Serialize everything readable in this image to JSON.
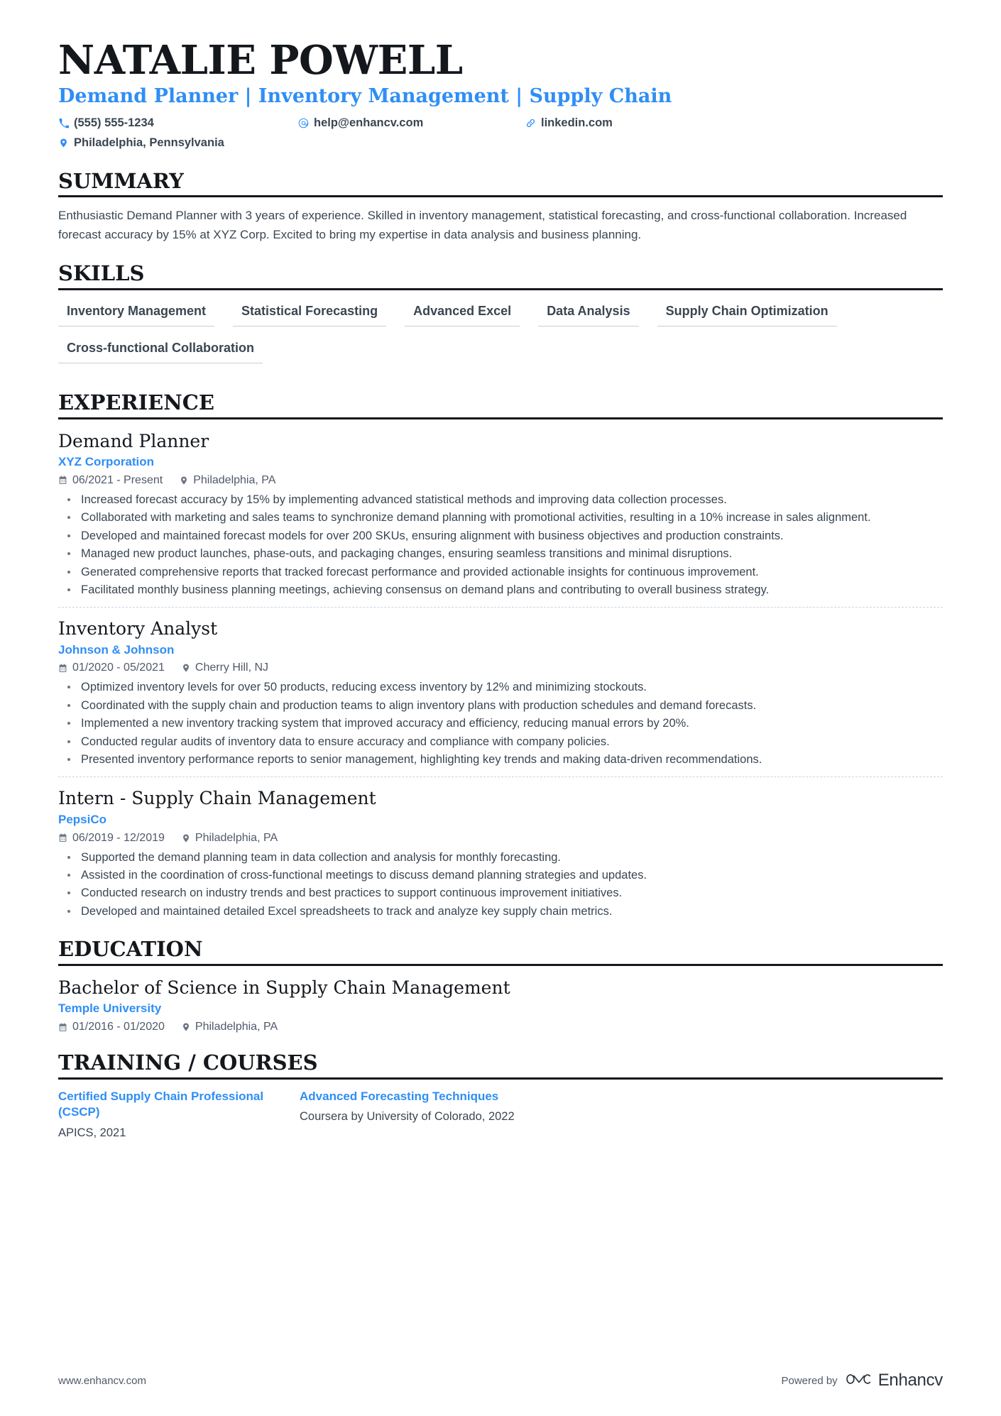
{
  "accent_color": "#2f8ef4",
  "text_color": "#3a4652",
  "heading_color": "#14181d",
  "header": {
    "name": "NATALIE POWELL",
    "headline": "Demand Planner | Inventory Management | Supply Chain",
    "contacts": [
      {
        "icon": "phone-icon",
        "text": "(555) 555-1234"
      },
      {
        "icon": "email-icon",
        "text": "help@enhancv.com"
      },
      {
        "icon": "link-icon",
        "text": "linkedin.com"
      },
      {
        "icon": "location-icon",
        "text": "Philadelphia, Pennsylvania"
      }
    ]
  },
  "sections": {
    "summary": {
      "title": "SUMMARY",
      "text": "Enthusiastic Demand Planner with 3 years of experience. Skilled in inventory management, statistical forecasting, and cross-functional collaboration. Increased forecast accuracy by 15% at XYZ Corp. Excited to bring my expertise in data analysis and business planning."
    },
    "skills": {
      "title": "SKILLS",
      "items": [
        "Inventory Management",
        "Statistical Forecasting",
        "Advanced Excel",
        "Data Analysis",
        "Supply Chain Optimization",
        "Cross-functional Collaboration"
      ]
    },
    "experience": {
      "title": "EXPERIENCE",
      "entries": [
        {
          "title": "Demand Planner",
          "org": "XYZ Corporation",
          "dates": "06/2021 - Present",
          "location": "Philadelphia, PA",
          "bullets": [
            "Increased forecast accuracy by 15% by implementing advanced statistical methods and improving data collection processes.",
            "Collaborated with marketing and sales teams to synchronize demand planning with promotional activities, resulting in a 10% increase in sales alignment.",
            "Developed and maintained forecast models for over 200 SKUs, ensuring alignment with business objectives and production constraints.",
            "Managed new product launches, phase-outs, and packaging changes, ensuring seamless transitions and minimal disruptions.",
            "Generated comprehensive reports that tracked forecast performance and provided actionable insights for continuous improvement.",
            "Facilitated monthly business planning meetings, achieving consensus on demand plans and contributing to overall business strategy."
          ]
        },
        {
          "title": "Inventory Analyst",
          "org": "Johnson & Johnson",
          "dates": "01/2020 - 05/2021",
          "location": "Cherry Hill, NJ",
          "bullets": [
            "Optimized inventory levels for over 50 products, reducing excess inventory by 12% and minimizing stockouts.",
            "Coordinated with the supply chain and production teams to align inventory plans with production schedules and demand forecasts.",
            "Implemented a new inventory tracking system that improved accuracy and efficiency, reducing manual errors by 20%.",
            "Conducted regular audits of inventory data to ensure accuracy and compliance with company policies.",
            "Presented inventory performance reports to senior management, highlighting key trends and making data-driven recommendations."
          ]
        },
        {
          "title": "Intern - Supply Chain Management",
          "org": "PepsiCo",
          "dates": "06/2019 - 12/2019",
          "location": "Philadelphia, PA",
          "bullets": [
            "Supported the demand planning team in data collection and analysis for monthly forecasting.",
            "Assisted in the coordination of cross-functional meetings to discuss demand planning strategies and updates.",
            "Conducted research on industry trends and best practices to support continuous improvement initiatives.",
            "Developed and maintained detailed Excel spreadsheets to track and analyze key supply chain metrics."
          ]
        }
      ]
    },
    "education": {
      "title": "EDUCATION",
      "entries": [
        {
          "title": "Bachelor of Science in Supply Chain Management",
          "org": "Temple University",
          "dates": "01/2016 - 01/2020",
          "location": "Philadelphia, PA"
        }
      ]
    },
    "courses": {
      "title": "TRAINING / COURSES",
      "items": [
        {
          "title": "Certified Supply Chain Professional (CSCP)",
          "sub": "APICS, 2021"
        },
        {
          "title": "Advanced Forecasting Techniques",
          "sub": "Coursera by University of Colorado, 2022"
        }
      ]
    }
  },
  "footer": {
    "website": "www.enhancv.com",
    "powered_by": "Powered by",
    "brand": "Enhancv"
  }
}
